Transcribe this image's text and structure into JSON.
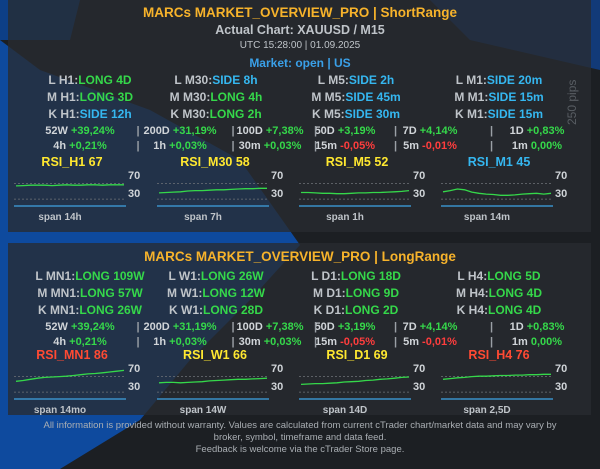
{
  "colors": {
    "long": "#35d84a",
    "side": "#35b7f0",
    "pos": "#35d84a",
    "neg": "#ff3d3d",
    "rsi_line": "#35d84a",
    "rsi_base": "#3a90c8",
    "title": "#f7b32b",
    "rsi_red": "#ff4a33",
    "rsi_yellow": "#ffe830",
    "rsi_blue": "#35b7f0"
  },
  "short": {
    "title": "MARCs MARKET_OVERVIEW_PRO | ShortRange",
    "chart_label": "Actual Chart: XAUUSD / M15",
    "datetime": "UTC 15:28:00 | 01.09.2025",
    "market": "Market: open | US",
    "tf_rows": [
      [
        {
          "k": "L H1:",
          "v": "LONG 4D",
          "cls": "long"
        },
        {
          "k": "L M30:",
          "v": "SIDE 8h",
          "cls": "side"
        },
        {
          "k": "L M5:",
          "v": "SIDE 2h",
          "cls": "side"
        },
        {
          "k": "L M1:",
          "v": "SIDE 20m",
          "cls": "side"
        }
      ],
      [
        {
          "k": "M H1:",
          "v": "LONG 3D",
          "cls": "long"
        },
        {
          "k": "M M30:",
          "v": "LONG 4h",
          "cls": "long"
        },
        {
          "k": "M M5:",
          "v": "SIDE 45m",
          "cls": "side"
        },
        {
          "k": "M M1:",
          "v": "SIDE 15m",
          "cls": "side"
        }
      ],
      [
        {
          "k": "K H1:",
          "v": "SIDE 12h",
          "cls": "side"
        },
        {
          "k": "K M30:",
          "v": "LONG 2h",
          "cls": "long"
        },
        {
          "k": "K M5:",
          "v": "SIDE 30m",
          "cls": "side"
        },
        {
          "k": "K M1:",
          "v": "SIDE 15m",
          "cls": "side"
        }
      ]
    ],
    "perf_rows": [
      [
        {
          "k": "52W",
          "v": "+39,24%",
          "cls": "pos"
        },
        {
          "k": "200D",
          "v": "+31,19%",
          "cls": "pos"
        },
        {
          "k": "100D",
          "v": "+7,38%",
          "cls": "pos"
        },
        {
          "k": "50D",
          "v": "+3,19%",
          "cls": "pos"
        },
        {
          "k": "7D",
          "v": "+4,14%",
          "cls": "pos"
        },
        {
          "k": "1D",
          "v": "+0,83%",
          "cls": "pos"
        }
      ],
      [
        {
          "k": "4h",
          "v": "+0,21%",
          "cls": "pos"
        },
        {
          "k": "1h",
          "v": "+0,03%",
          "cls": "pos"
        },
        {
          "k": "30m",
          "v": "+0,03%",
          "cls": "pos"
        },
        {
          "k": "15m",
          "v": "-0,05%",
          "cls": "neg"
        },
        {
          "k": "5m",
          "v": "-0,01%",
          "cls": "neg"
        },
        {
          "k": "1m",
          "v": "0,00%",
          "cls": "pos"
        }
      ]
    ],
    "rsi": [
      {
        "label": "RSI_H1 67",
        "color": "#ffe830",
        "span": "span 14h",
        "values": [
          64,
          65,
          66,
          66,
          66,
          65,
          66,
          67,
          66,
          66,
          67,
          67,
          66,
          67,
          67,
          67
        ]
      },
      {
        "label": "RSI_M30 58",
        "color": "#ffe830",
        "span": "span 7h",
        "values": [
          46,
          47,
          48,
          49,
          51,
          52,
          52,
          53,
          54,
          54,
          55,
          56,
          57,
          57,
          58,
          58
        ]
      },
      {
        "label": "RSI_M5 52",
        "color": "#ffe830",
        "span": "span 1h",
        "values": [
          47,
          47,
          46,
          45,
          45,
          44,
          44,
          45,
          46,
          46,
          47,
          47,
          48,
          49,
          50,
          52
        ]
      },
      {
        "label": "RSI_M1 45",
        "color": "#35b7f0",
        "span": "span 14m",
        "values": [
          49,
          52,
          56,
          54,
          48,
          45,
          43,
          42,
          40,
          40,
          41,
          43,
          44,
          45,
          43,
          45
        ]
      }
    ]
  },
  "long": {
    "title": "MARCs MARKET_OVERVIEW_PRO | LongRange",
    "tf_rows": [
      [
        {
          "k": "L MN1:",
          "v": "LONG 109W",
          "cls": "long"
        },
        {
          "k": "L W1:",
          "v": "LONG 26W",
          "cls": "long"
        },
        {
          "k": "L D1:",
          "v": "LONG 18D",
          "cls": "long"
        },
        {
          "k": "L H4:",
          "v": "LONG 5D",
          "cls": "long"
        }
      ],
      [
        {
          "k": "M MN1:",
          "v": "LONG 57W",
          "cls": "long"
        },
        {
          "k": "M W1:",
          "v": "LONG 12W",
          "cls": "long"
        },
        {
          "k": "M D1:",
          "v": "LONG 9D",
          "cls": "long"
        },
        {
          "k": "M H4:",
          "v": "LONG 4D",
          "cls": "long"
        }
      ],
      [
        {
          "k": "K MN1:",
          "v": "LONG 26W",
          "cls": "long"
        },
        {
          "k": "K W1:",
          "v": "LONG 28D",
          "cls": "long"
        },
        {
          "k": "K D1:",
          "v": "LONG 2D",
          "cls": "long"
        },
        {
          "k": "K H4:",
          "v": "LONG 4D",
          "cls": "long"
        }
      ]
    ],
    "perf_rows": [
      [
        {
          "k": "52W",
          "v": "+39,24%",
          "cls": "pos"
        },
        {
          "k": "200D",
          "v": "+31,19%",
          "cls": "pos"
        },
        {
          "k": "100D",
          "v": "+7,38%",
          "cls": "pos"
        },
        {
          "k": "50D",
          "v": "+3,19%",
          "cls": "pos"
        },
        {
          "k": "7D",
          "v": "+4,14%",
          "cls": "pos"
        },
        {
          "k": "1D",
          "v": "+0,83%",
          "cls": "pos"
        }
      ],
      [
        {
          "k": "4h",
          "v": "+0,21%",
          "cls": "pos"
        },
        {
          "k": "1h",
          "v": "+0,03%",
          "cls": "pos"
        },
        {
          "k": "30m",
          "v": "+0,03%",
          "cls": "pos"
        },
        {
          "k": "15m",
          "v": "-0,05%",
          "cls": "neg"
        },
        {
          "k": "5m",
          "v": "-0,01%",
          "cls": "neg"
        },
        {
          "k": "1m",
          "v": "0,00%",
          "cls": "pos"
        }
      ]
    ],
    "rsi": [
      {
        "label": "RSI_MN1 86",
        "color": "#ff4a33",
        "span": "span 14mo",
        "values": [
          58,
          60,
          63,
          66,
          68,
          69,
          70,
          71,
          73,
          75,
          77,
          78,
          80,
          82,
          84,
          86
        ]
      },
      {
        "label": "RSI_W1 66",
        "color": "#ffe830",
        "span": "span 14W",
        "values": [
          54,
          55,
          55,
          54,
          55,
          56,
          57,
          59,
          60,
          61,
          62,
          63,
          63,
          64,
          65,
          66
        ]
      },
      {
        "label": "RSI_D1 69",
        "color": "#ffe830",
        "span": "span 14D",
        "values": [
          50,
          51,
          52,
          52,
          53,
          54,
          56,
          57,
          58,
          60,
          61,
          63,
          64,
          66,
          68,
          69
        ]
      },
      {
        "label": "RSI_H4 76",
        "color": "#ff4a33",
        "span": "span 2,5D",
        "values": [
          63,
          65,
          67,
          68,
          70,
          71,
          71,
          72,
          73,
          73,
          74,
          74,
          75,
          75,
          76,
          76
        ]
      }
    ]
  },
  "rsi_levels": {
    "upper": "70",
    "lower": "30"
  },
  "pips_label": "250 pips",
  "footer": [
    "All information is provided without warranty. Values are calculated from current cTrader chart/market data and may vary by",
    "broker, symbol, timeframe and data feed.",
    "Feedback is welcome via the cTrader Store page."
  ]
}
